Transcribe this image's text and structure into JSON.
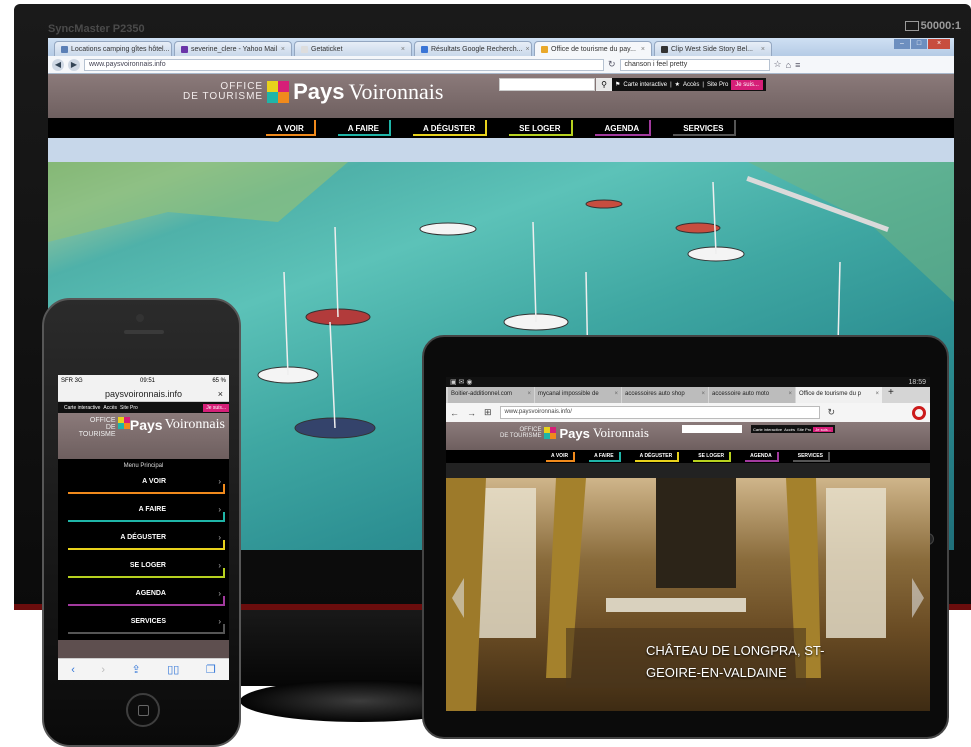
{
  "monitor": {
    "brand": "SyncMaster P2350",
    "contrast": "50000:1"
  },
  "desktop_browser": {
    "tabs": [
      {
        "label": "Locations camping gîtes hôtel...",
        "active": false
      },
      {
        "label": "severine_clere - Yahoo Mail",
        "active": false
      },
      {
        "label": "Getaticket",
        "active": false
      },
      {
        "label": "Résultats Google Recherch...",
        "active": false
      },
      {
        "label": "Office de tourisme du pay...",
        "active": true
      },
      {
        "label": "Clip West Side Story Bel...",
        "active": false
      }
    ],
    "url": "www.paysvoironnais.info",
    "search_query": "chanson i feel pretty"
  },
  "site": {
    "logo_office": "OFFICE",
    "logo_tourisme": "DE TOURISME",
    "logo_pays": "Pays",
    "logo_voironnais": "Voironnais",
    "search_icon": "search-icon",
    "util_links": {
      "carte": "Carte interactive",
      "acces": "Accès",
      "site_pro": "Site Pro",
      "je_suis": "Je suis..."
    },
    "nav": [
      {
        "label": "A VOIR",
        "color": "#f08a1c"
      },
      {
        "label": "A FAIRE",
        "color": "#1fb5a8"
      },
      {
        "label": "A DÉGUSTER",
        "color": "#e8d21c"
      },
      {
        "label": "SE LOGER",
        "color": "#b7d11f"
      },
      {
        "label": "AGENDA",
        "color": "#a23a9e"
      },
      {
        "label": "SERVICES",
        "color": "#555555"
      }
    ]
  },
  "phone": {
    "status_left": "SFR 3G",
    "status_time": "09:51",
    "status_battery": "65 %",
    "url": "paysvoironnais.info",
    "menu_title": "Menu Principal",
    "toolbar_icons": [
      "back-icon",
      "forward-icon",
      "share-icon",
      "bookmarks-icon",
      "tabs-icon"
    ]
  },
  "tablet": {
    "status_time": "18:59",
    "tabs": [
      {
        "label": "Boitier-additionnel.com",
        "active": false
      },
      {
        "label": "mycanal impossible de",
        "active": false
      },
      {
        "label": "accessoires auto shop",
        "active": false
      },
      {
        "label": "accessoire auto moto",
        "active": false
      },
      {
        "label": "Office de tourisme du p",
        "active": true
      }
    ],
    "url": "www.paysvoironnais.info/",
    "hero_caption": "CHÂTEAU DE LONGPRA, ST-GEOIRE-EN-VALDAINE"
  }
}
